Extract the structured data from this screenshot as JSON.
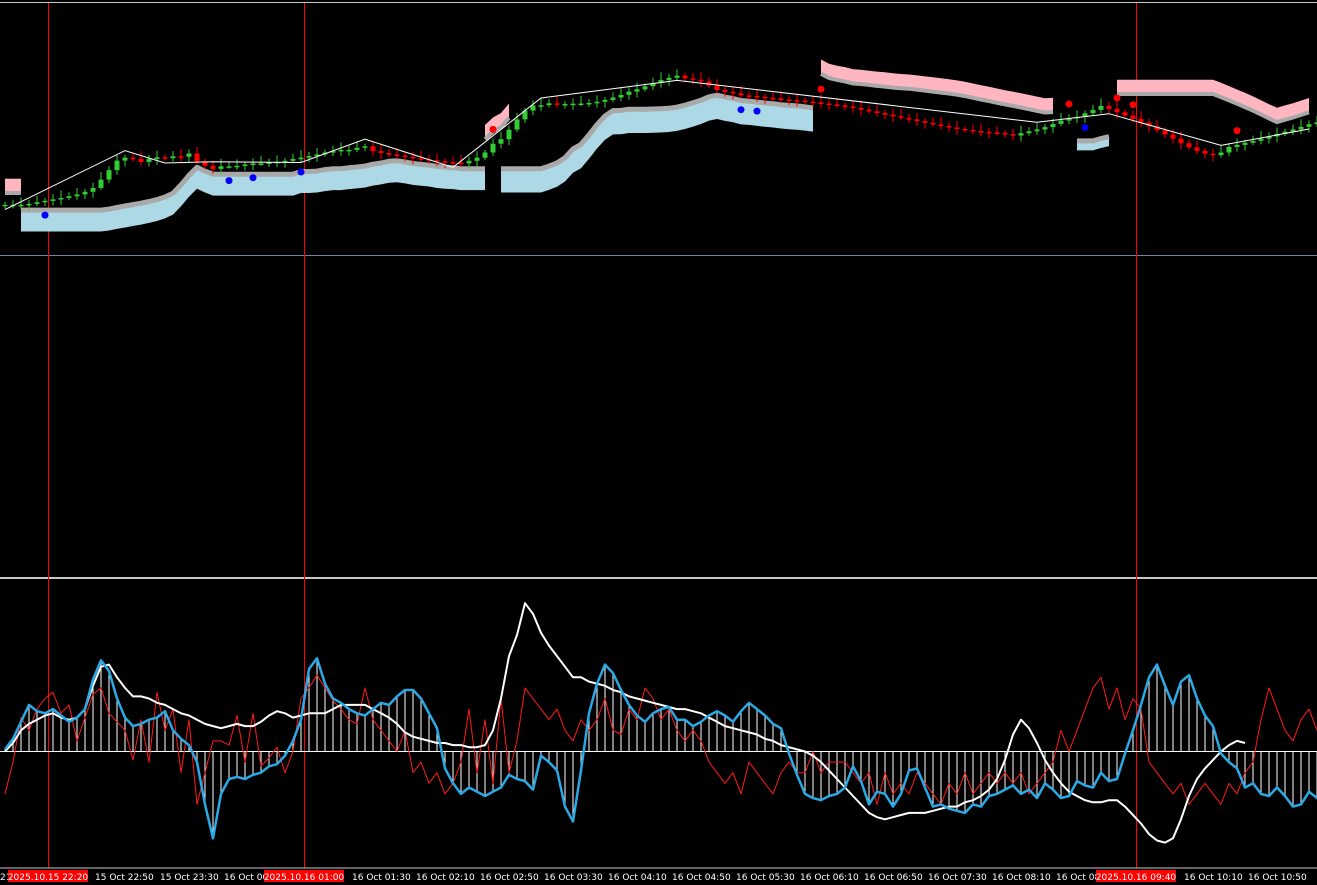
{
  "colors": {
    "background": "#000000",
    "bull": "#33cc33",
    "bear": "#ff0000",
    "cloud_support": "#add8e6",
    "cloud_resistance": "#ffb6c1",
    "cloud_edge": "#a9a9a9",
    "zigzag": "#ffffff",
    "dot_buy": "#0000ff",
    "dot_sell": "#ff0000",
    "vline": "#ff0000",
    "hline": "#6f86a8",
    "osc_blue": "#29a9e6",
    "osc_white": "#ffffff",
    "osc_red": "#ff1a1a",
    "marker_bg": "#ff0000"
  },
  "time_axis": {
    "labels": [
      "15 Oct 22:50",
      "15 Oct 23:30",
      "16 Oct 00",
      "16 Oct 01:30",
      "16 Oct 02:10",
      "16 Oct 02:50",
      "16 Oct 03:30",
      "16 Oct 04:10",
      "16 Oct 04:50",
      "16 Oct 05:30",
      "16 Oct 06:10",
      "16 Oct 06:50",
      "16 Oct 07:30",
      "16 Oct 08:10",
      "16 Oct 08",
      "16 Oct 10:10",
      "16 Oct 10:50"
    ],
    "cut_left_label": "21",
    "markers": [
      "2025.10.15 22:20",
      "2025.10.16 01:00",
      "2025.10.16 09:40"
    ]
  },
  "chart_data": [
    {
      "type": "candlestick",
      "panel": "price",
      "title": "",
      "x": [
        0,
        1,
        2,
        3,
        4,
        5,
        6,
        7,
        8,
        9,
        10,
        11,
        12,
        13,
        14,
        15,
        16,
        17,
        18,
        19,
        20,
        21,
        22,
        23,
        24,
        25,
        26,
        27,
        28,
        29,
        30,
        31,
        32,
        33,
        34,
        35,
        36,
        37,
        38,
        39,
        40,
        41,
        42,
        43,
        44,
        45,
        46,
        47,
        48,
        49,
        50,
        51,
        52,
        53,
        54,
        55,
        56,
        57,
        58,
        59,
        60,
        61,
        62,
        63,
        64,
        65,
        66,
        67,
        68,
        69,
        70,
        71,
        72,
        73,
        74,
        75,
        76,
        77,
        78,
        79,
        80,
        81,
        82,
        83,
        84,
        85,
        86,
        87,
        88,
        89,
        90,
        91,
        92,
        93,
        94,
        95,
        96,
        97,
        98,
        99,
        100,
        101,
        102,
        103,
        104,
        105,
        106,
        107,
        108,
        109,
        110,
        111,
        112,
        113,
        114,
        115,
        116,
        117,
        118,
        119,
        120,
        121,
        122,
        123,
        124,
        125,
        126,
        127,
        128,
        129,
        130,
        131,
        132,
        133,
        134,
        135,
        136,
        137,
        138,
        139,
        140,
        141,
        142,
        143,
        144,
        145,
        146,
        147,
        148,
        149,
        150,
        151,
        152,
        153,
        154,
        155,
        156,
        157,
        158,
        159,
        160,
        161,
        162,
        163
      ],
      "close": [
        16.0,
        16.0,
        16.0,
        16.4,
        17.1,
        17.7,
        18.3,
        18.9,
        19.6,
        20.4,
        21.5,
        23.1,
        26.6,
        30.6,
        34.6,
        35.8,
        35.3,
        34.0,
        35.3,
        36.0,
        35.6,
        36.4,
        36.2,
        37.6,
        34.3,
        32.4,
        31.1,
        32.2,
        32.2,
        32.4,
        33.0,
        33.4,
        33.4,
        33.8,
        34.1,
        34.5,
        35.3,
        35.8,
        36.5,
        37.2,
        38.0,
        38.6,
        39.1,
        39.1,
        40.0,
        40.6,
        38.6,
        37.8,
        37.1,
        36.7,
        36.2,
        35.6,
        35.2,
        34.9,
        34.3,
        34.0,
        33.8,
        33.4,
        34.5,
        35.8,
        38.0,
        41.7,
        43.6,
        47.6,
        51.9,
        55.6,
        57.8,
        57.9,
        58.7,
        58.4,
        58.4,
        58.5,
        58.6,
        58.8,
        59.3,
        60.1,
        61.1,
        62.2,
        63.6,
        64.6,
        65.8,
        67.2,
        68.5,
        69.4,
        70.3,
        69.2,
        68.6,
        67.9,
        66.1,
        64.3,
        63.5,
        62.9,
        62.0,
        61.8,
        61.4,
        61.0,
        60.7,
        60.3,
        60.0,
        59.8,
        59.4,
        59.0,
        58.6,
        58.2,
        57.8,
        57.3,
        56.7,
        56.0,
        55.3,
        54.6,
        53.9,
        53.2,
        52.6,
        51.9,
        51.2,
        50.5,
        49.8,
        49.1,
        48.5,
        47.9,
        47.4,
        47.0,
        46.7,
        46.4,
        46.2,
        45.7,
        45.1,
        46.1,
        46.9,
        47.7,
        48.7,
        50.0,
        51.4,
        52.4,
        53.0,
        54.5,
        55.9,
        57.6,
        56.3,
        54.9,
        53.5,
        52.1,
        50.6,
        49.0,
        47.3,
        45.6,
        43.8,
        41.9,
        40.2,
        38.7,
        37.5,
        36.9,
        38.0,
        40.3,
        41.2,
        42.1,
        42.9,
        43.8,
        44.8,
        45.8,
        46.8,
        47.7,
        48.8,
        49.9,
        50.7,
        51.4
      ],
      "ylim": [
        -140,
        100
      ]
    },
    {
      "type": "line",
      "panel": "oscillator",
      "title": "",
      "x": [
        0,
        1,
        2,
        3,
        4,
        5,
        6,
        7,
        8,
        9,
        10,
        11,
        12,
        13,
        14,
        15,
        16,
        17,
        18,
        19,
        20,
        21,
        22,
        23,
        24,
        25,
        26,
        27,
        28,
        29,
        30,
        31,
        32,
        33,
        34,
        35,
        36,
        37,
        38,
        39,
        40,
        41,
        42,
        43,
        44,
        45,
        46,
        47,
        48,
        49,
        50,
        51,
        52,
        53,
        54,
        55,
        56,
        57,
        58,
        59,
        60,
        61,
        62,
        63,
        64,
        65,
        66,
        67,
        68,
        69,
        70,
        71,
        72,
        73,
        74,
        75,
        76,
        77,
        78,
        79,
        80,
        81,
        82,
        83,
        84,
        85,
        86,
        87,
        88,
        89,
        90,
        91,
        92,
        93,
        94,
        95,
        96,
        97,
        98,
        99,
        100,
        101,
        102,
        103,
        104,
        105,
        106,
        107,
        108,
        109,
        110,
        111,
        112,
        113,
        114,
        115,
        116,
        117,
        118,
        119,
        120,
        121,
        122,
        123,
        124,
        125,
        126,
        127,
        128,
        129,
        130,
        131,
        132,
        133,
        134,
        135,
        136,
        137,
        138,
        139,
        140,
        141,
        142,
        143,
        144,
        145,
        146,
        147,
        148,
        149,
        150,
        151,
        152,
        153,
        154,
        155,
        156,
        157,
        158,
        159,
        160,
        161,
        162,
        163
      ],
      "series": [
        {
          "values": [
            2,
            12,
            28,
            44,
            38,
            36,
            40,
            34,
            28,
            32,
            40,
            68,
            86,
            76,
            50,
            32,
            24,
            26,
            30,
            32,
            38,
            20,
            12,
            6,
            -10,
            -50,
            -82,
            -40,
            -26,
            -24,
            -26,
            -22,
            -20,
            -14,
            -12,
            -4,
            10,
            30,
            78,
            88,
            64,
            50,
            46,
            40,
            36,
            34,
            40,
            46,
            44,
            52,
            58,
            58,
            50,
            36,
            22,
            -16,
            -30,
            -40,
            -34,
            -38,
            -42,
            -38,
            -34,
            -22,
            -26,
            -28,
            -36,
            -4,
            -10,
            -18,
            -52,
            -66,
            -18,
            36,
            64,
            82,
            74,
            58,
            44,
            34,
            28,
            36,
            40,
            42,
            30,
            30,
            24,
            28,
            34,
            38,
            34,
            28,
            38,
            46,
            40,
            34,
            26,
            22,
            -2,
            -22,
            -40,
            -44,
            -46,
            -42,
            -40,
            -34,
            -14,
            -28,
            -50,
            -38,
            -40,
            -52,
            -40,
            -18,
            -16,
            -34,
            -52,
            -50,
            -54,
            -56,
            -58,
            -50,
            -52,
            -42,
            -40,
            -36,
            -32,
            -40,
            -36,
            -44,
            -30,
            -36,
            -44,
            -42,
            -28,
            -32,
            -34,
            -20,
            -28,
            -26,
            -2,
            20,
            44,
            70,
            82,
            62,
            44,
            66,
            72,
            50,
            34,
            24,
            -2,
            -10,
            -16,
            -34,
            -30,
            -40,
            -42,
            -34,
            -42,
            -52,
            -50,
            -38,
            -44,
            -46,
            -48,
            -50,
            -44,
            -32,
            4,
            18,
            44,
            54,
            50,
            40,
            38,
            44,
            42,
            32
          ]
        },
        {
          "values": [
            0,
            8,
            20,
            26,
            30,
            34,
            36,
            32,
            30,
            32,
            40,
            62,
            80,
            82,
            70,
            60,
            52,
            52,
            50,
            46,
            44,
            40,
            36,
            34,
            30,
            26,
            24,
            22,
            24,
            26,
            24,
            24,
            28,
            34,
            38,
            36,
            32,
            34,
            36,
            36,
            36,
            40,
            44,
            44,
            44,
            44,
            40,
            36,
            32,
            26,
            18,
            14,
            12,
            10,
            8,
            8,
            6,
            6,
            4,
            4,
            6,
            20,
            50,
            90,
            110,
            140,
            130,
            112,
            100,
            90,
            80,
            70,
            70,
            66,
            64,
            62,
            58,
            56,
            52,
            50,
            48,
            46,
            44,
            42,
            40,
            40,
            38,
            36,
            32,
            28,
            24,
            22,
            20,
            18,
            16,
            12,
            10,
            6,
            4,
            2,
            0,
            -4,
            -10,
            -18,
            -26,
            -34,
            -42,
            -50,
            -58,
            -62,
            -64,
            -62,
            -60,
            -58,
            -58,
            -58,
            -56,
            -54,
            -52,
            -52,
            -48,
            -46,
            -42,
            -36,
            -26,
            -8,
            16,
            30,
            22,
            8,
            -8,
            -20,
            -30,
            -38,
            -42,
            -46,
            -48,
            -48,
            -46,
            -46,
            -52,
            -60,
            -68,
            -78,
            -84,
            -86,
            -82,
            -64,
            -42,
            -26,
            -16,
            -8,
            0,
            6,
            10,
            8
          ]
        },
        {
          "values": [
            -40,
            -10,
            32,
            20,
            40,
            50,
            56,
            36,
            44,
            10,
            32,
            54,
            60,
            36,
            28,
            20,
            -8,
            30,
            -10,
            56,
            20,
            40,
            -20,
            30,
            -50,
            -20,
            10,
            10,
            6,
            34,
            -10,
            36,
            -14,
            -6,
            4,
            -20,
            0,
            50,
            60,
            72,
            60,
            48,
            40,
            30,
            26,
            60,
            30,
            20,
            10,
            0,
            20,
            -20,
            -10,
            -30,
            -20,
            -40,
            -30,
            -10,
            40,
            -20,
            30,
            -30,
            50,
            -20,
            10,
            60,
            50,
            40,
            30,
            40,
            20,
            10,
            30,
            20,
            30,
            50,
            20,
            16,
            40,
            30,
            60,
            50,
            30,
            40,
            20,
            10,
            20,
            10,
            -10,
            -20,
            -30,
            -20,
            -40,
            -10,
            -20,
            -30,
            -40,
            -20,
            -10,
            -20,
            -20,
            0,
            -20,
            -10,
            -10,
            -10,
            -20,
            -30,
            -20,
            -50,
            -20,
            -40,
            -30,
            -40,
            -20,
            -30,
            -40,
            -50,
            -30,
            -40,
            -20,
            -40,
            -30,
            -20,
            -30,
            -20,
            -30,
            -20,
            -40,
            -30,
            -20,
            -10,
            20,
            0,
            20,
            40,
            60,
            70,
            40,
            60,
            30,
            50,
            40,
            -10,
            -20,
            -30,
            -40,
            -30,
            -50,
            -40,
            -30,
            -40,
            -50,
            -30,
            -40,
            -20,
            -10,
            30,
            60,
            40,
            20,
            10,
            30,
            40,
            20,
            10
          ]
        }
      ],
      "histogram": [
        2,
        12,
        28,
        44,
        38,
        36,
        40,
        34,
        28,
        32,
        40,
        68,
        86,
        76,
        50,
        32,
        24,
        26,
        30,
        32,
        38,
        20,
        12,
        6,
        -10,
        -50,
        -82,
        -40,
        -26,
        -24,
        -26,
        -22,
        -20,
        -14,
        -12,
        -4,
        10,
        30,
        78,
        88,
        64,
        50,
        46,
        40,
        36,
        34,
        40,
        46,
        44,
        52,
        58,
        58,
        50,
        36,
        22,
        -16,
        -30,
        -40,
        -34,
        -38,
        -42,
        -38,
        -34,
        -22,
        -26,
        -28,
        -36,
        -4,
        -10,
        -18,
        -52,
        -66,
        -18,
        36,
        64,
        82,
        74,
        58,
        44,
        34,
        28,
        36,
        40,
        42,
        30,
        30,
        24,
        28,
        34,
        38,
        34,
        28,
        38,
        46,
        40,
        34,
        26,
        22,
        -2,
        -22,
        -40,
        -44,
        -46,
        -42,
        -40,
        -34,
        -14,
        -28,
        -50,
        -38,
        -40,
        -52,
        -40,
        -18,
        -16,
        -34,
        -52,
        -50,
        -54,
        -56,
        -58,
        -50,
        -52,
        -42,
        -40,
        -36,
        -32,
        -40,
        -36,
        -44,
        -30,
        -36,
        -44,
        -42,
        -28,
        -32,
        -34,
        -20,
        -28,
        -26,
        -2,
        20,
        44,
        70,
        82,
        62,
        44,
        66,
        72,
        50,
        34,
        24,
        -2,
        -10,
        -16,
        -34,
        -30,
        -40,
        -42,
        -34,
        -42,
        -52,
        -50,
        -38,
        -44,
        -46,
        -48,
        -50,
        -44,
        -32,
        4,
        18,
        44,
        54,
        50,
        40,
        38,
        44,
        42,
        32
      ],
      "ylim": [
        -110,
        160
      ]
    }
  ]
}
